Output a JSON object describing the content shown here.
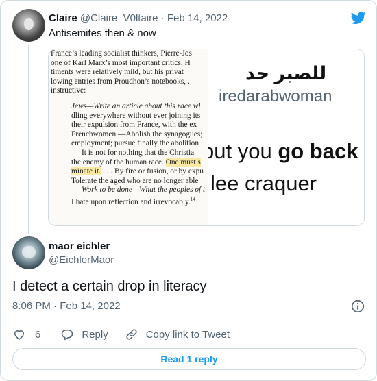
{
  "parent_tweet": {
    "name": "Claire",
    "handle": "@Claire_V0ltaire",
    "separator": "·",
    "date": "Feb 14, 2022",
    "text": "Antisemites then & now",
    "book_excerpt": [
      "France’s leading socialist thinkers, Pierre-Jos",
      "one of Karl Marx’s most important critics. H",
      "timents were relatively mild, but his privat",
      "lowing entries from Proudhon’s notebooks, .",
      "instructive:",
      "Jews—Write an article about this race wl",
      "dling everywhere without ever joining its",
      "their expulsion from France, with the ex",
      "Frenchwomen.—Abolish the synagogues;",
      "employment; pursue finally the abolition",
      "It is not for nothing that the Christia",
      "the enemy of the human race.",
      "One must s",
      "minate it.",
      ". . . By fire or fusion, or by expu",
      "Tolerate the aged who are no longer able",
      "Work to be done—What the peoples of t",
      "I hate upon reflection and irrevocably.",
      "14"
    ],
    "image_right": {
      "arabic": "للصبر حد",
      "handle": "iredarabwoman",
      "line1_start": "out you ",
      "line1_bold": "go back",
      "line2": "lee craquer"
    }
  },
  "main_tweet": {
    "name": "maor eichler",
    "handle": "@EichlerMaor",
    "text": "I detect a certain drop in literacy",
    "time": "8:06 PM",
    "separator": "·",
    "date": "Feb 14, 2022",
    "like_count": "6",
    "reply_label": "Reply",
    "copy_label": "Copy link to Tweet",
    "read_replies_label": "Read 1 reply"
  },
  "icons": {
    "brand": "twitter-bird-icon",
    "info": "info-icon",
    "like": "heart-icon",
    "reply": "reply-bubble-icon",
    "copy": "link-icon"
  },
  "colors": {
    "accent": "#1d9bf0",
    "secondary_text": "#536471",
    "border": "#cfd9de",
    "highlight": "#fbe9a6"
  }
}
